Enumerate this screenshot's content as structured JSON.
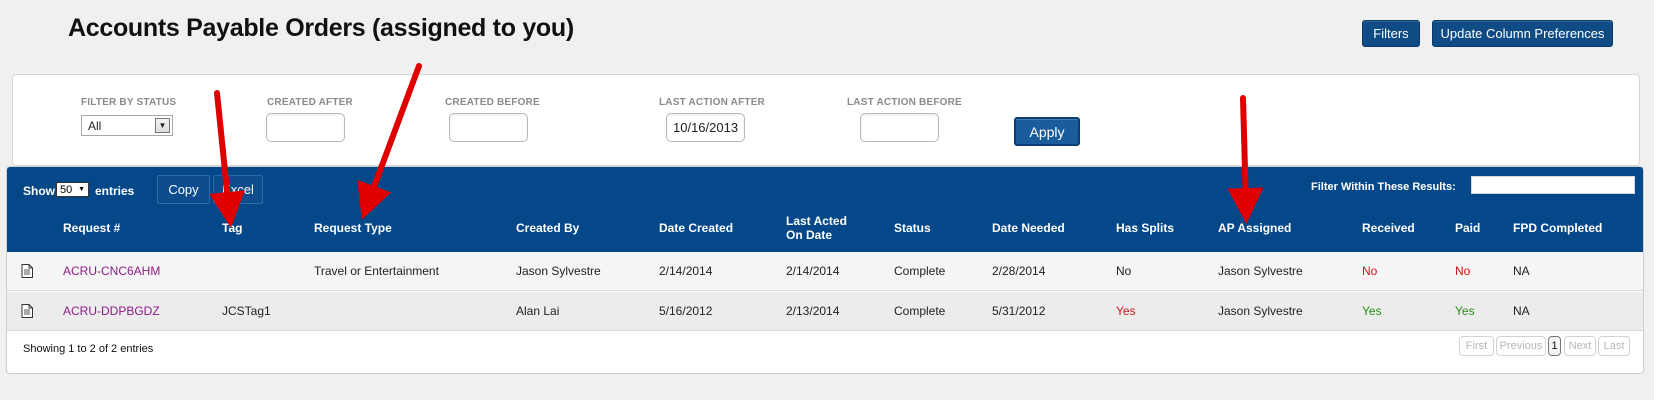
{
  "page": {
    "title": "Accounts Payable Orders (assigned to you)",
    "filters_button": "Filters",
    "column_prefs_button": "Update Column Preferences"
  },
  "filters": {
    "status_label": "FILTER BY STATUS",
    "status_value": "All",
    "created_after_label": "CREATED AFTER",
    "created_after_value": "",
    "created_before_label": "CREATED BEFORE",
    "created_before_value": "",
    "last_action_after_label": "LAST ACTION AFTER",
    "last_action_after_value": "10/16/2013",
    "last_action_before_label": "LAST ACTION BEFORE",
    "last_action_before_value": "",
    "apply_button": "Apply"
  },
  "table": {
    "show_label": "Show",
    "entries_per_page": "50",
    "entries_label": "entries",
    "copy_button": "Copy",
    "excel_button": "Excel",
    "filter_within_label": "Filter Within These Results:",
    "filter_within_value": "",
    "headers": {
      "request": "Request #",
      "tag": "Tag",
      "request_type": "Request Type",
      "created_by": "Created By",
      "date_created": "Date Created",
      "last_acted": "Last Acted On Date",
      "status": "Status",
      "date_needed": "Date Needed",
      "has_splits": "Has Splits",
      "ap_assigned": "AP Assigned",
      "received": "Received",
      "paid": "Paid",
      "fpd_completed": "FPD Completed"
    },
    "rows": [
      {
        "request": "ACRU-CNC6AHM",
        "tag": "",
        "request_type": "Travel or Entertainment",
        "created_by": "Jason Sylvestre",
        "date_created": "2/14/2014",
        "last_acted": "2/14/2014",
        "status": "Complete",
        "date_needed": "2/28/2014",
        "has_splits": "No",
        "ap_assigned": "Jason Sylvestre",
        "received": "No",
        "paid": "No",
        "fpd_completed": "NA"
      },
      {
        "request": "ACRU-DDPBGDZ",
        "tag": "JCSTag1",
        "request_type": "",
        "created_by": "Alan Lai",
        "date_created": "5/16/2012",
        "last_acted": "2/13/2014",
        "status": "Complete",
        "date_needed": "5/31/2012",
        "has_splits": "Yes",
        "ap_assigned": "Jason Sylvestre",
        "received": "Yes",
        "paid": "Yes",
        "fpd_completed": "NA"
      }
    ],
    "info": "Showing 1 to 2 of 2 entries",
    "pagination": {
      "first": "First",
      "previous": "Previous",
      "current": "1",
      "next": "Next",
      "last": "Last"
    }
  },
  "colors": {
    "header_blue": "#05488a",
    "link_purple": "#8a1d87",
    "no_red": "#d11515",
    "yes_green": "#2a8a1a",
    "annotation_arrow": "#e00000"
  }
}
